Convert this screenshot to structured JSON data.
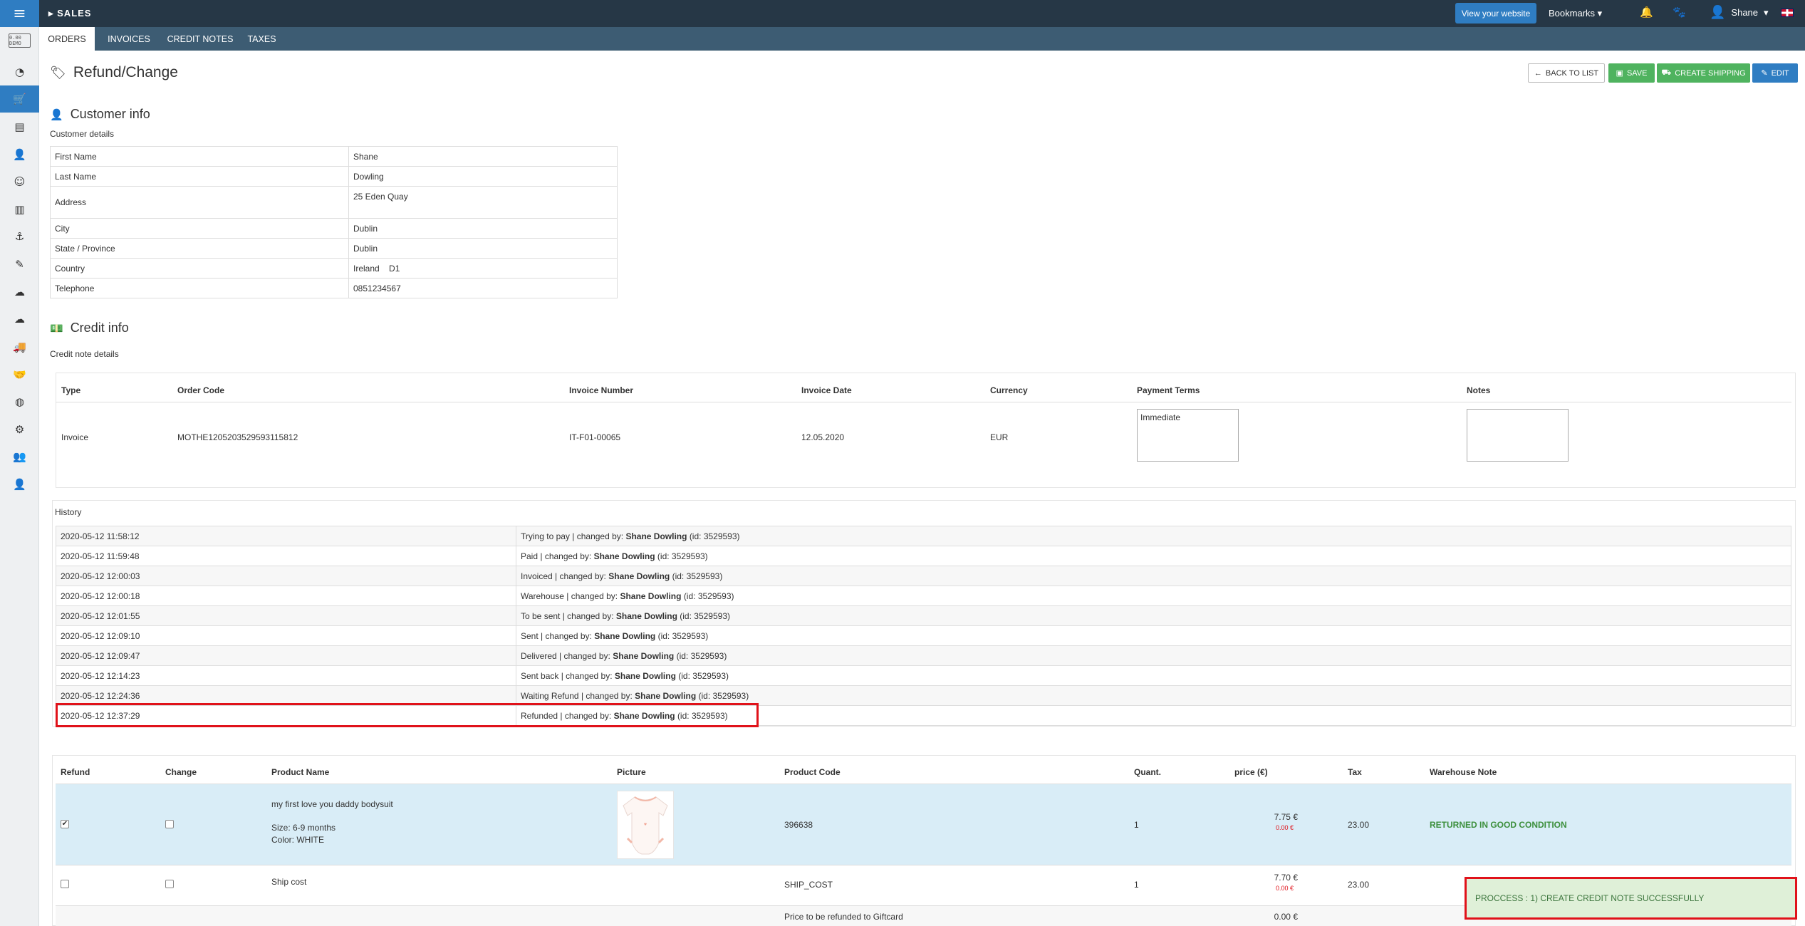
{
  "topbar": {
    "section": "SALES",
    "view_website": "View your website",
    "bookmarks": "Bookmarks",
    "user": "Shane"
  },
  "sidebar": {
    "logo_text": "0.00 DEMO",
    "items": [
      "dashboard-icon",
      "cart-icon",
      "box-icon",
      "user-icon",
      "smile-icon",
      "chart-icon",
      "anchor-icon",
      "edit-icon",
      "cloud-icon",
      "cloud-upload-icon",
      "truck-icon",
      "handshake-icon",
      "globe-icon",
      "gear-icon",
      "users-icon",
      "person-icon"
    ]
  },
  "tabs": [
    {
      "label": "ORDERS",
      "active": true
    },
    {
      "label": "INVOICES",
      "active": false
    },
    {
      "label": "CREDIT NOTES",
      "active": false
    },
    {
      "label": "TAXES",
      "active": false
    }
  ],
  "page": {
    "title": "Refund/Change",
    "buttons": {
      "back": "BACK TO LIST",
      "save": "SAVE",
      "create_shipping": "CREATE SHIPPING",
      "edit": "EDIT"
    }
  },
  "customer": {
    "heading": "Customer info",
    "subheading": "Customer details",
    "rows": [
      {
        "label": "First Name",
        "value": "Shane"
      },
      {
        "label": "Last Name",
        "value": "Dowling"
      },
      {
        "label": "Address",
        "value": "25 Eden Quay"
      },
      {
        "label": "City",
        "value": "Dublin"
      },
      {
        "label": "State / Province",
        "value": "Dublin"
      },
      {
        "label": "Country",
        "value": "Ireland    D1"
      },
      {
        "label": "Telephone",
        "value": "0851234567"
      }
    ]
  },
  "credit": {
    "heading": "Credit info",
    "subheading": "Credit note details",
    "headers": {
      "type": "Type",
      "order_code": "Order Code",
      "invoice_number": "Invoice Number",
      "invoice_date": "Invoice Date",
      "currency": "Currency",
      "payment_terms": "Payment Terms",
      "notes": "Notes"
    },
    "row": {
      "type": "Invoice",
      "order_code": "MOTHE1205203529593115812",
      "invoice_number": "IT-F01-00065",
      "invoice_date": "12.05.2020",
      "currency": "EUR",
      "payment_terms": "Immediate",
      "notes": ""
    }
  },
  "history": {
    "heading": "History",
    "rows": [
      {
        "date": "2020-05-12 11:58:12",
        "status": "Trying to pay",
        "changed_by_label": "changed by:",
        "user": "Shane Dowling",
        "id": "(id: 3529593)"
      },
      {
        "date": "2020-05-12 11:59:48",
        "status": "Paid",
        "changed_by_label": "changed by:",
        "user": "Shane Dowling",
        "id": "(id: 3529593)"
      },
      {
        "date": "2020-05-12 12:00:03",
        "status": "Invoiced",
        "changed_by_label": "changed by:",
        "user": "Shane Dowling",
        "id": "(id: 3529593)"
      },
      {
        "date": "2020-05-12 12:00:18",
        "status": "Warehouse",
        "changed_by_label": "changed by:",
        "user": "Shane Dowling",
        "id": "(id: 3529593)"
      },
      {
        "date": "2020-05-12 12:01:55",
        "status": "To be sent",
        "changed_by_label": "changed by:",
        "user": "Shane Dowling",
        "id": "(id: 3529593)"
      },
      {
        "date": "2020-05-12 12:09:10",
        "status": "Sent",
        "changed_by_label": "changed by:",
        "user": "Shane Dowling",
        "id": "(id: 3529593)"
      },
      {
        "date": "2020-05-12 12:09:47",
        "status": "Delivered",
        "changed_by_label": "changed by:",
        "user": "Shane Dowling",
        "id": "(id: 3529593)"
      },
      {
        "date": "2020-05-12 12:14:23",
        "status": "Sent back",
        "changed_by_label": "changed by:",
        "user": "Shane Dowling",
        "id": "(id: 3529593)"
      },
      {
        "date": "2020-05-12 12:24:36",
        "status": "Waiting Refund",
        "changed_by_label": "changed by:",
        "user": "Shane Dowling",
        "id": "(id: 3529593)"
      },
      {
        "date": "2020-05-12 12:37:29",
        "status": "Refunded",
        "changed_by_label": "changed by:",
        "user": "Shane Dowling",
        "id": "(id: 3529593)"
      }
    ]
  },
  "products": {
    "headers": {
      "refund": "Refund",
      "change": "Change",
      "name": "Product Name",
      "picture": "Picture",
      "code": "Product Code",
      "quant": "Quant.",
      "price": "price (€)",
      "tax": "Tax",
      "warehouse_note": "Warehouse Note"
    },
    "rows": [
      {
        "refund_checked": true,
        "change_checked": false,
        "name": "my first love you daddy bodysuit",
        "size": "Size: 6-9 months",
        "color": "Color: WHITE",
        "code": "396638",
        "quant": "1",
        "price": "7.75 €",
        "price_red": "0.00 €",
        "tax": "23.00",
        "warehouse_note": "RETURNED IN GOOD CONDITION"
      },
      {
        "refund_checked": false,
        "change_checked": false,
        "name": "Ship cost",
        "code": "SHIP_COST",
        "quant": "1",
        "price": "7.70 €",
        "price_red": "0.00 €",
        "tax": "23.00"
      }
    ],
    "giftcard_label": "Price to be refunded to Giftcard",
    "giftcard_value": "0.00 €"
  },
  "notice": "PROCCESS : 1) CREATE CREDIT NOTE SUCCESSFULLY"
}
